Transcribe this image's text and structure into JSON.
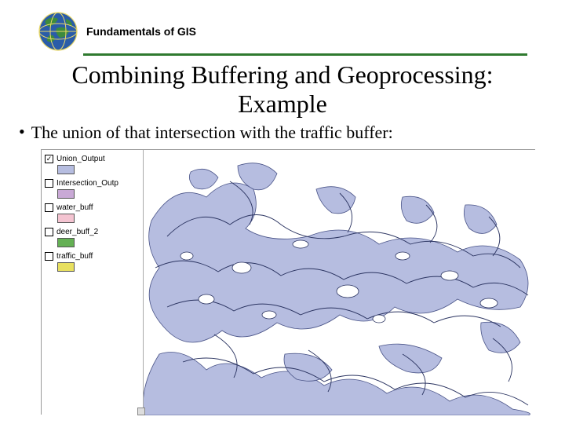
{
  "header": {
    "title": "Fundamentals of GIS"
  },
  "slide": {
    "title": "Combining Buffering and Geoprocessing: Example",
    "bullet": "The union of that intersection with the traffic buffer:"
  },
  "legend": {
    "items": [
      {
        "label": "Union_Output",
        "checked": true,
        "swatch": "#b6bde0"
      },
      {
        "label": "Intersection_Outp",
        "checked": false,
        "swatch": "#c9a9d6"
      },
      {
        "label": "water_buff",
        "checked": false,
        "swatch": "#f4c4d1"
      },
      {
        "label": "deer_buff_2",
        "checked": false,
        "swatch": "#64b054"
      },
      {
        "label": "traffic_buff",
        "checked": false,
        "swatch": "#e8e060"
      }
    ]
  },
  "icons": {
    "globe": "globe-icon"
  }
}
